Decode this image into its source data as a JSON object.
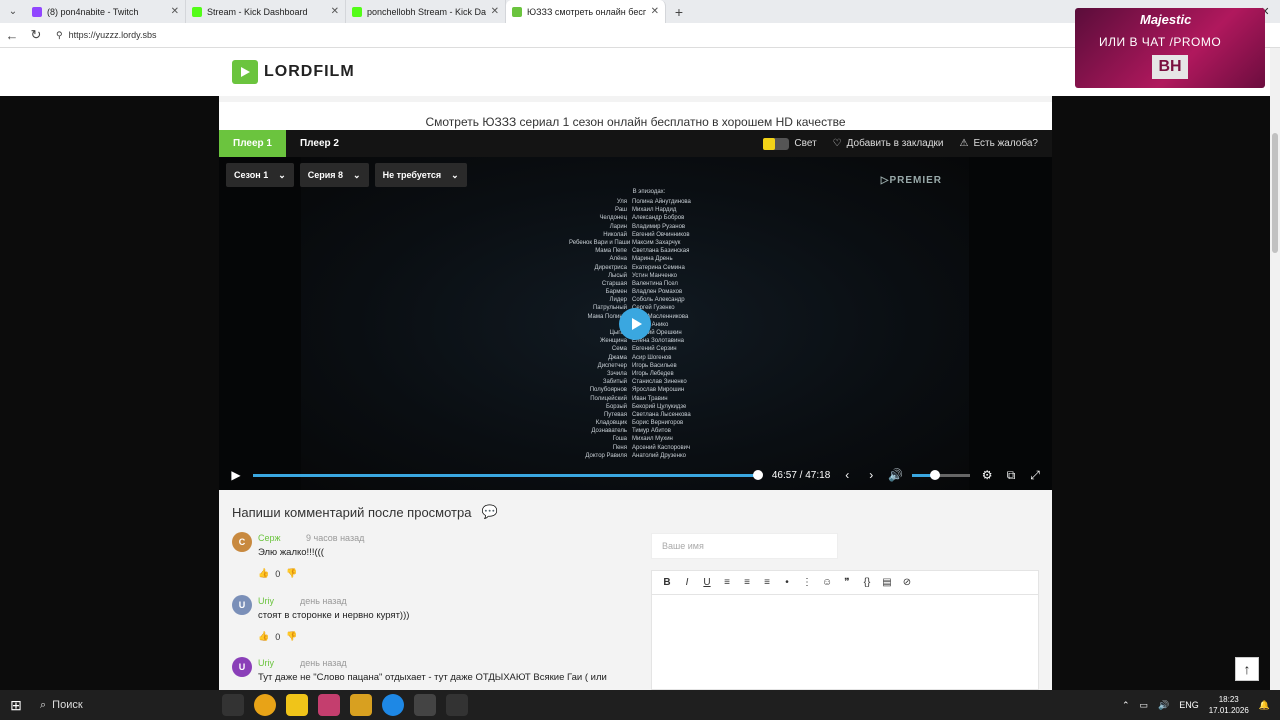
{
  "browser": {
    "tabs": [
      {
        "title": "(8) pon4nabite - Twitch",
        "color": "#9146ff",
        "active": false
      },
      {
        "title": "Stream - Kick Dashboard",
        "color": "#53fc18",
        "active": false
      },
      {
        "title": "ponchellobh Stream - Kick Dashb",
        "color": "#53fc18",
        "active": false
      },
      {
        "title": "ЮЗЗЗ смотреть онлайн бесплат",
        "color": "#6bc43e",
        "active": true
      }
    ],
    "url": "https://yuzzz.lordy.sbs"
  },
  "site": {
    "logo_text": "LORDFILM",
    "page_title": "Смотреть ЮЗЗЗ сериал 1 сезон онлайн бесплатно в хорошем HD качестве"
  },
  "ad": {
    "brand": "Majestic",
    "promo": "ИЛИ В ЧАТ /PROMO",
    "tag": "BH"
  },
  "player": {
    "tabs": [
      "Плеер 1",
      "Плеер 2"
    ],
    "light_label": "Свет",
    "bookmark_label": "Добавить в закладки",
    "complaint_label": "Есть жалоба?",
    "season": "Сезон 1",
    "episode": "Серия 8",
    "translation": "Не требуется",
    "watermark": "PREMIER",
    "current_time": "46:57",
    "duration": "47:18",
    "progress": 0.9926,
    "volume": 0.4
  },
  "credits": {
    "head": "В эпизодах:",
    "rows": [
      [
        "Уля",
        "Полина Айнутдинова"
      ],
      [
        "Раш",
        "Михаил Нардид"
      ],
      [
        "Челдонец",
        "Александр Бобров"
      ],
      [
        "Ларин",
        "Владимир Рузанов"
      ],
      [
        "Николай",
        "Евгений Овчинников"
      ],
      [
        "Ребенок Вари и Паши",
        "Максим Захарчук"
      ],
      [
        "Мама Пепе",
        "Светлана Базинская"
      ],
      [
        "Алёна",
        "Марина Дрень"
      ],
      [
        "Директриса",
        "Екатерина Семина"
      ],
      [
        "Лысый",
        "Устин Манченко"
      ],
      [
        "Старшая",
        "Валентина Псел"
      ],
      [
        "Бармен",
        "Владлен Ромахов"
      ],
      [
        "Лидер",
        "Соболь Александр"
      ],
      [
        "Патрульный",
        "Сергей Гузенко"
      ],
      [
        "Мама Полины",
        "Анна Масленникова"
      ],
      [
        "",
        "Ахмад Анико"
      ],
      [
        "Цыган",
        "Евгений Орешкин"
      ],
      [
        "Женщина",
        "Елена Золотавина"
      ],
      [
        "Сема",
        "Евгений Серзин"
      ],
      [
        "Джама",
        "Асир Шогенов"
      ],
      [
        "Диспетчер",
        "Игорь Васильев"
      ],
      [
        "Зэчила",
        "Игорь Лебедев"
      ],
      [
        "Забитый",
        "Станислав Зиненко"
      ],
      [
        "Полубоярнов",
        "Ярослав Мирошин"
      ],
      [
        "Полицейский",
        "Иван Травин"
      ],
      [
        "Борзый",
        "Бекорий Цулукидзе"
      ],
      [
        "Путевая",
        "Светлана Лысенкова"
      ],
      [
        "Кладовщик",
        "Борис Вернигоров"
      ],
      [
        "Дознаватель",
        "Тимур Абитов"
      ],
      [
        "Гоша",
        "Михаил Мухин"
      ],
      [
        "Пеня",
        "Арсений Каспорович"
      ],
      [
        "Доктор Равиля",
        "Анатолий Друзенко"
      ]
    ]
  },
  "comments": {
    "title": "Напиши комментарий после просмотра",
    "name_placeholder": "Ваше имя",
    "items": [
      {
        "initial": "С",
        "author": "Серж",
        "time": "9 часов назад",
        "text": "Элю жалко!!!(((",
        "likes": "0",
        "color": "#c8893f"
      },
      {
        "initial": "U",
        "author": "Uriy",
        "time": "день назад",
        "text": "стоят в сторонке и нервно курят)))",
        "likes": "0",
        "color": "#7a8fb8"
      },
      {
        "initial": "U",
        "author": "Uriy",
        "time": "день назад",
        "text": "Тут даже не \"Слово пацана\" отдыхает - тут даже ОТДЫХАЮТ Всякие Гаи ( или",
        "likes": "",
        "color": "#8a3fb8"
      }
    ]
  },
  "taskbar": {
    "search": "Поиск",
    "lang": "ENG",
    "time": "18:23",
    "date": "17.01.2026"
  }
}
